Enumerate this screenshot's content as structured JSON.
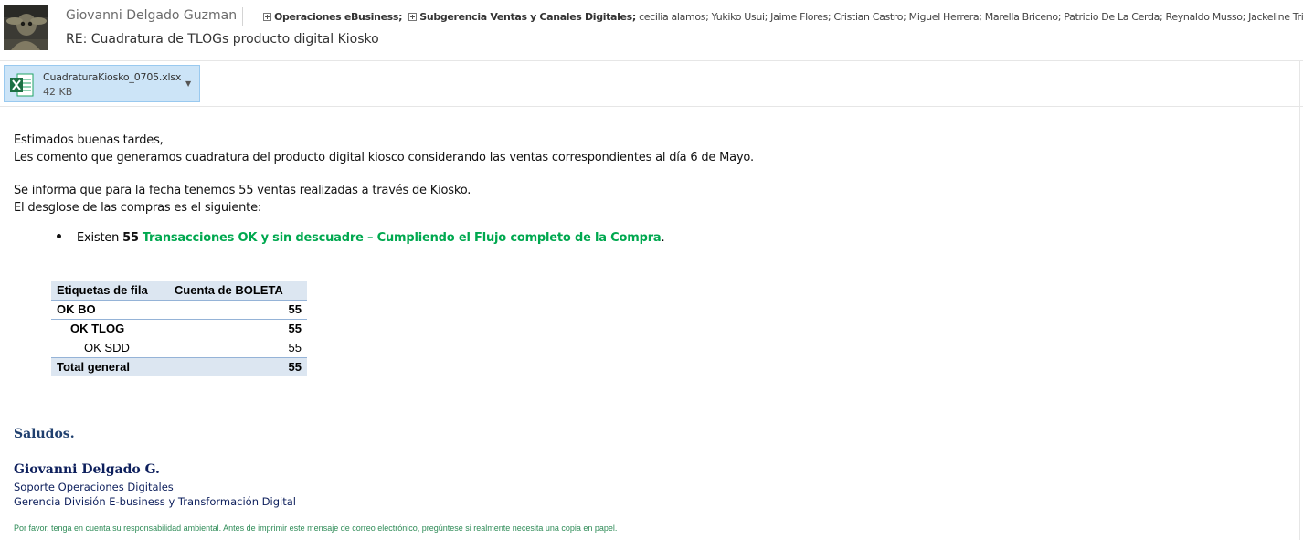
{
  "header": {
    "sender": "Giovanni Delgado Guzman",
    "subject": "RE: Cuadratura de TLOGs producto digital Kiosko",
    "recipients": {
      "groups": [
        "Operaciones eBusiness;",
        "Subgerencia Ventas y Canales Digitales;"
      ],
      "people": "cecilia alamos; Yukiko Usui; Jaime Flores; Cristian Castro; Miguel Herrera; Marella Briceno; Patricio De La Cerda; Reynaldo Musso; Jackeline Trivino"
    }
  },
  "attachment": {
    "name": "CuadraturaKiosko_0705.xlsx",
    "size": "42 KB",
    "icon": "excel-icon"
  },
  "body": {
    "greeting": "Estimados buenas tardes,",
    "line1": "Les comento que generamos cuadratura del producto digital kiosco considerando las ventas correspondientes al día 6 de Mayo.",
    "line2": "Se informa que para la fecha tenemos 55 ventas realizadas a través de Kiosko.",
    "line3": "El desglose de las compras es el siguiente:",
    "bullet": {
      "prefix": "Existen",
      "number": "55",
      "highlight": "Transacciones OK y sin descuadre – Cumpliendo el Flujo completo de la Compra",
      "suffix": "."
    }
  },
  "pivot": {
    "headers": [
      "Etiquetas de fila",
      "Cuenta de BOLETA"
    ],
    "rows": [
      {
        "label": "OK BO",
        "value": "55"
      },
      {
        "label": "OK TLOG",
        "value": "55"
      },
      {
        "label": "OK SDD",
        "value": "55"
      }
    ],
    "total": {
      "label": "Total general",
      "value": "55"
    }
  },
  "signature": {
    "closing": "Saludos.",
    "name": "Giovanni Delgado G.",
    "role": "Soporte Operaciones Digitales",
    "department": "Gerencia División E-business y Transformación Digital",
    "note": "Por favor, tenga en cuenta su responsabilidad ambiental. Antes de imprimir este mensaje de correo electrónico, pregúntese si realmente necesita una copia en papel."
  },
  "colors": {
    "attachment_bg": "#cce4f7",
    "highlight_green": "#00a84f",
    "pivot_header_bg": "#dce6f1",
    "signature_navy": "#0d1f5c",
    "footer_green": "#2e8b57"
  }
}
